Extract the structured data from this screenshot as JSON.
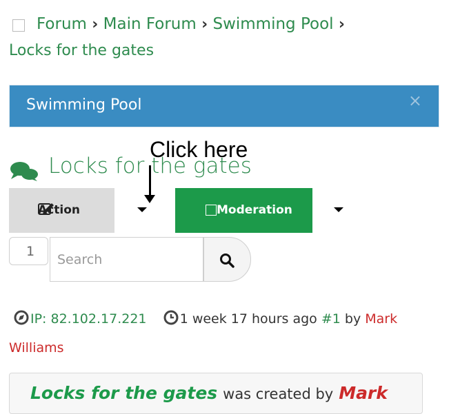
{
  "breadcrumb": {
    "items": [
      "Forum",
      "Main Forum",
      "Swimming Pool"
    ],
    "current": "Locks for the gates",
    "separator": "›"
  },
  "banner": {
    "title": "Swimming Pool",
    "close": "×"
  },
  "annotation": {
    "text": "Click here"
  },
  "topic": {
    "title": "Locks for the gates"
  },
  "toolbar": {
    "action_label": "Action",
    "moderation_label": "Moderation"
  },
  "pagination": {
    "page": "1"
  },
  "search": {
    "placeholder": "Search"
  },
  "meta": {
    "ip_label": "IP: 82.102.17.221",
    "time": "1 week 17 hours ago",
    "post_num": "#1",
    "by": "by",
    "author_first": "Mark",
    "author_last": "Williams"
  },
  "post": {
    "title": "Locks for the gates",
    "created_by": "was created by",
    "author": "Mark"
  },
  "colors": {
    "green": "#2e8b4e",
    "banner_blue": "#3a8cc2",
    "moderation_green": "#1c9a4a",
    "author_red": "#cc2a2a"
  }
}
